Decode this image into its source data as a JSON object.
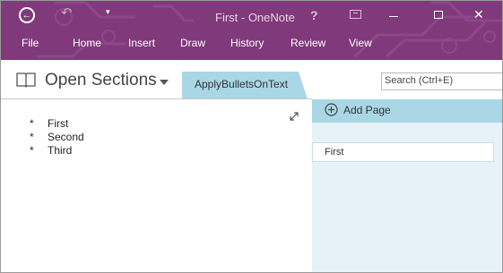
{
  "app": {
    "window_title": "First - OneNote"
  },
  "title_bar": {
    "help_label": "?",
    "close_label": "✕",
    "qat_more_label": "▾"
  },
  "ribbon": {
    "tabs": [
      "File",
      "Home",
      "Insert",
      "Draw",
      "History",
      "Review",
      "View"
    ]
  },
  "notebook": {
    "sections_label": "Open Sections",
    "active_section": "ApplyBulletsOnText"
  },
  "search": {
    "placeholder": "Search (Ctrl+E)"
  },
  "page": {
    "bullets": [
      {
        "marker": "*",
        "text": "First"
      },
      {
        "marker": "*",
        "text": "Second"
      },
      {
        "marker": "*",
        "text": "Third"
      }
    ]
  },
  "pages_pane": {
    "add_page_label": "Add Page",
    "pages": [
      "First"
    ]
  },
  "colors": {
    "ribbon_purple": "#80397b",
    "tab_blue": "#a9d7e5",
    "pane_blue": "#e6f2f7"
  }
}
